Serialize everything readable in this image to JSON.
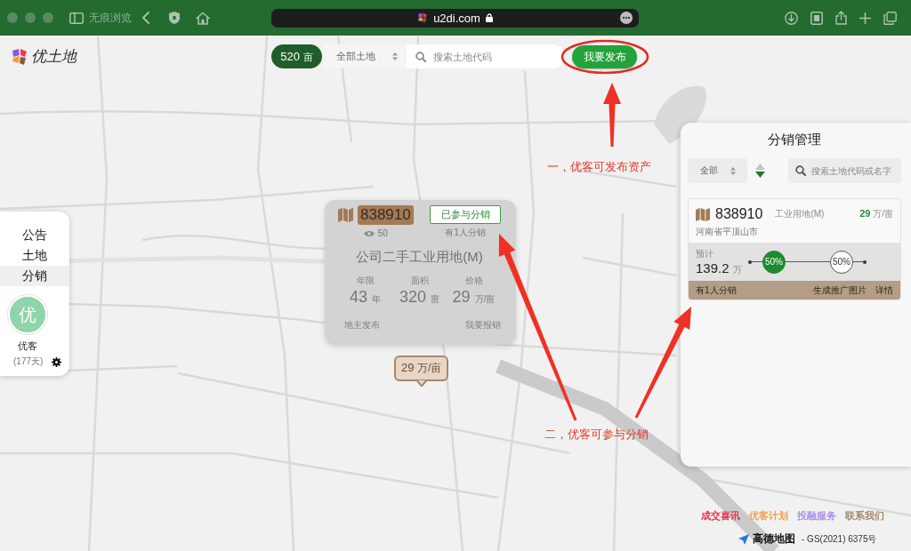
{
  "browser": {
    "private_label": "无痕浏览",
    "url": "u2di.com"
  },
  "logo": {
    "text": "优土地"
  },
  "top_bar": {
    "count": "520",
    "count_unit": "亩",
    "filter": "全部土地",
    "search": {
      "placeholder": "搜索土地代码"
    }
  },
  "publish_button": {
    "label": "我要发布"
  },
  "side_menu": {
    "items": [
      {
        "label": "公告",
        "selected": false
      },
      {
        "label": "土地",
        "selected": false
      },
      {
        "label": "分销",
        "selected": true
      }
    ],
    "user": {
      "avatar": "优",
      "name": "优客",
      "days": "(177天)"
    }
  },
  "land_popup": {
    "code": "838910",
    "status_button": "已参与分销",
    "views": "50",
    "distributors": "有1人分销",
    "title": "公司二手工业用地(M)",
    "stats": [
      {
        "label": "年限",
        "value": "43",
        "unit": "年"
      },
      {
        "label": "面积",
        "value": "320",
        "unit": "亩"
      },
      {
        "label": "价格",
        "value": "29",
        "unit": "万/亩"
      }
    ],
    "publisher": "地主发布",
    "action": "我要报销"
  },
  "price_marker": {
    "value": "29",
    "unit": "万/亩"
  },
  "distribution_panel": {
    "title": "分销管理",
    "filter": "全部",
    "sort_descending": true,
    "search": {
      "placeholder": "搜索土地代码或名字"
    },
    "items": [
      {
        "code": "838910",
        "type": "工业用地(M)",
        "price": "29",
        "price_unit": "万/亩",
        "location": "河南省平顶山市",
        "estimate_label": "预计",
        "estimate": "139.2",
        "estimate_unit": "万",
        "shares": [
          {
            "text": "50%",
            "highlighted": true
          },
          {
            "text": "50%",
            "highlighted": false
          }
        ],
        "distributors": "有1人分销",
        "actions": [
          {
            "label": "生成推广图片"
          },
          {
            "label": "详情"
          }
        ]
      }
    ]
  },
  "annotations": [
    {
      "text": "一，优客可发布资产"
    },
    {
      "text": "二，优客可参与分销"
    }
  ],
  "footer_links": [
    {
      "label": "成交喜讯",
      "color": "#e8344e"
    },
    {
      "label": "优客计划",
      "color": "#f0a050"
    },
    {
      "label": "投融服务",
      "color": "#a891ec"
    },
    {
      "label": "联系我们",
      "color": "#a5876a"
    }
  ],
  "map_attribution": {
    "brand": "高德地图",
    "license": "- GS(2021) 6375号"
  }
}
